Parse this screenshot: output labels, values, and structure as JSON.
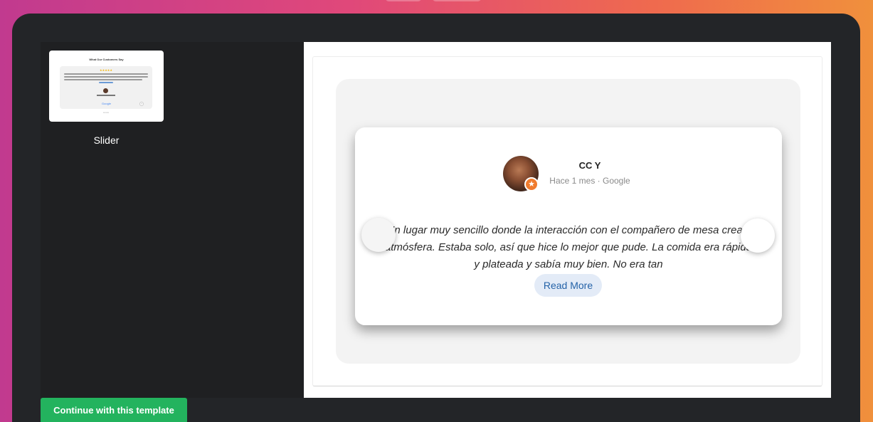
{
  "sidebar": {
    "templates": [
      {
        "label": "Slider",
        "thumbnail": {
          "title": "What Our Customers Say",
          "stars": "★★★★★",
          "brand": "Google",
          "dots": "●●●"
        }
      }
    ]
  },
  "review": {
    "reviewer_name": "CC Y",
    "meta": "Hace 1 mes · Google",
    "text": "\"Un lugar muy sencillo donde la interacción con el compañero de mesa crea la atmósfera. Estaba solo, así que hice lo mejor que pude. La comida era rápida y plateada y sabía muy bien. No era tan",
    "read_more_label": "Read More",
    "badge_icon": "star-badge-icon"
  },
  "footer": {
    "continue_label": "Continue with this template"
  },
  "colors": {
    "continue_button": "#23b35e",
    "read_more_bg": "#e3ebf7",
    "read_more_text": "#2563a8",
    "badge": "#f07b2d"
  }
}
